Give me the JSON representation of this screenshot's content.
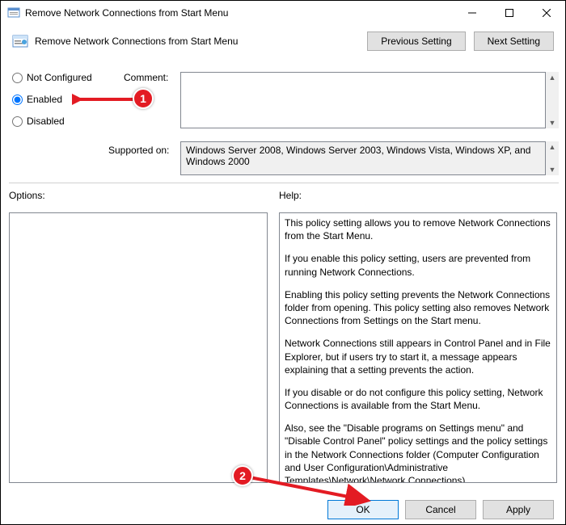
{
  "window": {
    "title": "Remove Network Connections from Start Menu"
  },
  "subheader": {
    "label": "Remove Network Connections from Start Menu"
  },
  "nav": {
    "previous": "Previous Setting",
    "next": "Next Setting"
  },
  "radios": {
    "not_configured": "Not Configured",
    "enabled": "Enabled",
    "disabled": "Disabled",
    "selected": "enabled"
  },
  "labels": {
    "comment": "Comment:",
    "supported_on": "Supported on:",
    "options": "Options:",
    "help": "Help:"
  },
  "fields": {
    "comment": "",
    "supported_on": "Windows Server 2008, Windows Server 2003, Windows Vista, Windows XP, and Windows 2000"
  },
  "help_paragraphs": [
    "This policy setting allows you to remove Network Connections from the Start Menu.",
    "If you enable this policy setting, users are prevented from running Network Connections.",
    "Enabling this policy setting prevents the Network Connections folder from opening. This policy setting also removes Network Connections from Settings on the Start menu.",
    "Network Connections still appears in Control Panel and in File Explorer, but if users try to start it, a message appears explaining that a setting prevents the action.",
    "If you disable or do not configure this policy setting, Network Connections is available from the Start Menu.",
    "Also, see the \"Disable programs on Settings menu\" and \"Disable Control Panel\" policy settings and the policy settings in the Network Connections folder (Computer Configuration and User Configuration\\Administrative Templates\\Network\\Network Connections)."
  ],
  "buttons": {
    "ok": "OK",
    "cancel": "Cancel",
    "apply": "Apply"
  },
  "annotations": {
    "badge1": "1",
    "badge2": "2"
  }
}
